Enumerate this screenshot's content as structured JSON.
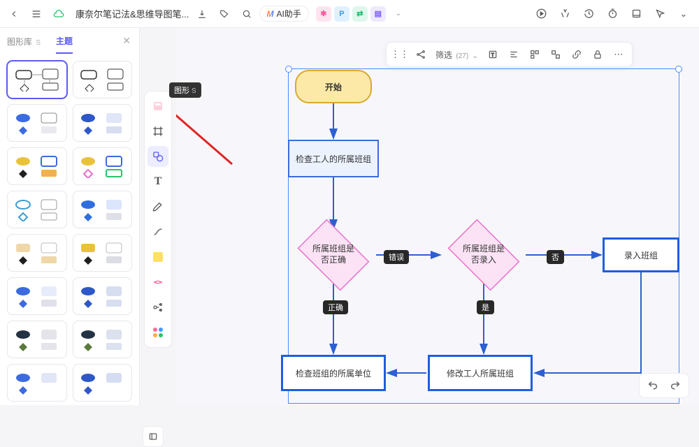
{
  "header": {
    "doc_title": "康奈尔笔记法&思维导图笔...",
    "ai_label": "AI助手",
    "apps": [
      {
        "letter": "*",
        "bg": "#ffe4ef",
        "fg": "#ff5aa0"
      },
      {
        "letter": "P",
        "bg": "#dff1ff",
        "fg": "#2b9fff"
      },
      {
        "letter": "⇄",
        "bg": "#dff7ec",
        "fg": "#14b86a"
      },
      {
        "letter": "☰",
        "bg": "#eee9ff",
        "fg": "#7b5cff"
      }
    ]
  },
  "sidebar": {
    "tabs": {
      "lib": "图形库",
      "lib_key": "S",
      "theme": "主题"
    }
  },
  "rail": {
    "tooltip_label": "图形",
    "tooltip_key": "S"
  },
  "context": {
    "filter_label": "筛选",
    "filter_count": "(27)"
  },
  "flow": {
    "start": "开始",
    "check_group": "检查工人的所属班组",
    "group_correct_q": "所属班组是\n否正确",
    "group_entered_q": "所属班组是\n否录入",
    "enter_group": "录入班组",
    "check_unit": "检查班组的所属单位",
    "modify_group": "修改工人所属班组",
    "label_wrong": "错误",
    "label_correct": "正确",
    "label_no": "否",
    "label_yes": "是"
  }
}
